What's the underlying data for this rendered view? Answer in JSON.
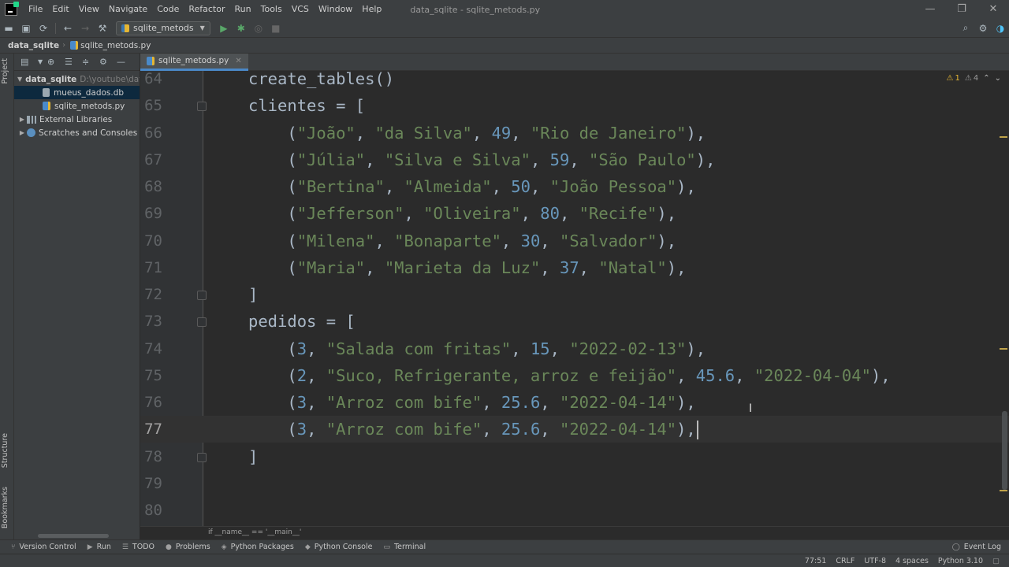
{
  "window": {
    "title": "data_sqlite - sqlite_metods.py"
  },
  "menu": [
    "File",
    "Edit",
    "View",
    "Navigate",
    "Code",
    "Refactor",
    "Run",
    "Tools",
    "VCS",
    "Window",
    "Help"
  ],
  "toolbar": {
    "run_config": "sqlite_metods"
  },
  "navbar": {
    "project": "data_sqlite",
    "file": "sqlite_metods.py"
  },
  "side_labels": {
    "project": "Project",
    "structure": "Structure",
    "bookmarks": "Bookmarks"
  },
  "project_tree": {
    "root": {
      "name": "data_sqlite",
      "path": "D:\\youtube\\dat"
    },
    "files": [
      "mueus_dados.db",
      "sqlite_metods.py"
    ],
    "external": "External Libraries",
    "scratches": "Scratches and Consoles"
  },
  "tab": {
    "label": "sqlite_metods.py"
  },
  "inspections": {
    "warnings": "1",
    "weak": "4"
  },
  "lines": [
    {
      "n": "64",
      "tokens": [
        [
          "i",
          "create_tables()"
        ]
      ]
    },
    {
      "n": "65",
      "tokens": [
        [
          "i",
          "clientes = ["
        ]
      ]
    },
    {
      "n": "66",
      "tokens": [
        [
          "i",
          "    ("
        ],
        [
          "s",
          "\"João\""
        ],
        [
          "i",
          ", "
        ],
        [
          "s",
          "\"da Silva\""
        ],
        [
          "i",
          ", "
        ],
        [
          "n",
          "49"
        ],
        [
          "i",
          ", "
        ],
        [
          "s",
          "\"Rio de Janeiro\""
        ],
        [
          "i",
          "),"
        ]
      ]
    },
    {
      "n": "67",
      "tokens": [
        [
          "i",
          "    ("
        ],
        [
          "s",
          "\"Júlia\""
        ],
        [
          "i",
          ", "
        ],
        [
          "s",
          "\"Silva e Silva\""
        ],
        [
          "i",
          ", "
        ],
        [
          "n",
          "59"
        ],
        [
          "i",
          ", "
        ],
        [
          "s",
          "\"São Paulo\""
        ],
        [
          "i",
          "),"
        ]
      ]
    },
    {
      "n": "68",
      "tokens": [
        [
          "i",
          "    ("
        ],
        [
          "s",
          "\"Bertina\""
        ],
        [
          "i",
          ", "
        ],
        [
          "s",
          "\"Almeida\""
        ],
        [
          "i",
          ", "
        ],
        [
          "n",
          "50"
        ],
        [
          "i",
          ", "
        ],
        [
          "s",
          "\"João Pessoa\""
        ],
        [
          "i",
          "),"
        ]
      ]
    },
    {
      "n": "69",
      "tokens": [
        [
          "i",
          "    ("
        ],
        [
          "s",
          "\"Jefferson\""
        ],
        [
          "i",
          ", "
        ],
        [
          "s",
          "\"Oliveira\""
        ],
        [
          "i",
          ", "
        ],
        [
          "n",
          "80"
        ],
        [
          "i",
          ", "
        ],
        [
          "s",
          "\"Recife\""
        ],
        [
          "i",
          "),"
        ]
      ]
    },
    {
      "n": "70",
      "tokens": [
        [
          "i",
          "    ("
        ],
        [
          "s",
          "\"Milena\""
        ],
        [
          "i",
          ", "
        ],
        [
          "s",
          "\"Bonaparte\""
        ],
        [
          "i",
          ", "
        ],
        [
          "n",
          "30"
        ],
        [
          "i",
          ", "
        ],
        [
          "s",
          "\"Salvador\""
        ],
        [
          "i",
          "),"
        ]
      ]
    },
    {
      "n": "71",
      "tokens": [
        [
          "i",
          "    ("
        ],
        [
          "s",
          "\"Maria\""
        ],
        [
          "i",
          ", "
        ],
        [
          "s",
          "\"Marieta da Luz\""
        ],
        [
          "i",
          ", "
        ],
        [
          "n",
          "37"
        ],
        [
          "i",
          ", "
        ],
        [
          "s",
          "\"Natal\""
        ],
        [
          "i",
          "),"
        ]
      ]
    },
    {
      "n": "72",
      "tokens": [
        [
          "i",
          "]"
        ]
      ]
    },
    {
      "n": "73",
      "tokens": [
        [
          "i",
          "pedidos = ["
        ]
      ]
    },
    {
      "n": "74",
      "tokens": [
        [
          "i",
          "    ("
        ],
        [
          "n",
          "3"
        ],
        [
          "i",
          ", "
        ],
        [
          "s",
          "\"Salada com fritas\""
        ],
        [
          "i",
          ", "
        ],
        [
          "n",
          "15"
        ],
        [
          "i",
          ", "
        ],
        [
          "s",
          "\"2022-02-13\""
        ],
        [
          "i",
          "),"
        ]
      ]
    },
    {
      "n": "75",
      "tokens": [
        [
          "i",
          "    ("
        ],
        [
          "n",
          "2"
        ],
        [
          "i",
          ", "
        ],
        [
          "s",
          "\"Suco, Refrigerante, arroz e feijão\""
        ],
        [
          "i",
          ", "
        ],
        [
          "n",
          "45.6"
        ],
        [
          "i",
          ", "
        ],
        [
          "s",
          "\"2022-04-04\""
        ],
        [
          "i",
          "),"
        ]
      ]
    },
    {
      "n": "76",
      "tokens": [
        [
          "i",
          "    ("
        ],
        [
          "n",
          "3"
        ],
        [
          "i",
          ", "
        ],
        [
          "s",
          "\"Arroz com bife\""
        ],
        [
          "i",
          ", "
        ],
        [
          "n",
          "25.6"
        ],
        [
          "i",
          ", "
        ],
        [
          "s",
          "\"2022-04-14\""
        ],
        [
          "i",
          "),"
        ]
      ]
    },
    {
      "n": "77",
      "tokens": [
        [
          "i",
          "    ("
        ],
        [
          "n",
          "3"
        ],
        [
          "i",
          ", "
        ],
        [
          "s",
          "\"Arroz com bife\""
        ],
        [
          "i",
          ", "
        ],
        [
          "n",
          "25.6"
        ],
        [
          "i",
          ", "
        ],
        [
          "s",
          "\"2022-04-14\""
        ],
        [
          "i",
          "),"
        ]
      ]
    },
    {
      "n": "78",
      "tokens": [
        [
          "i",
          "]"
        ]
      ]
    },
    {
      "n": "79",
      "tokens": []
    },
    {
      "n": "80",
      "tokens": []
    }
  ],
  "current_line": "77",
  "editor_breadcrumb": "if __name__ == '__main__'",
  "bottom_tools": [
    "Version Control",
    "Run",
    "TODO",
    "Problems",
    "Python Packages",
    "Python Console",
    "Terminal"
  ],
  "event_log": "Event Log",
  "status": {
    "position": "77:51",
    "line_sep": "CRLF",
    "encoding": "UTF-8",
    "indent": "4 spaces",
    "interpreter": "Python 3.10"
  }
}
